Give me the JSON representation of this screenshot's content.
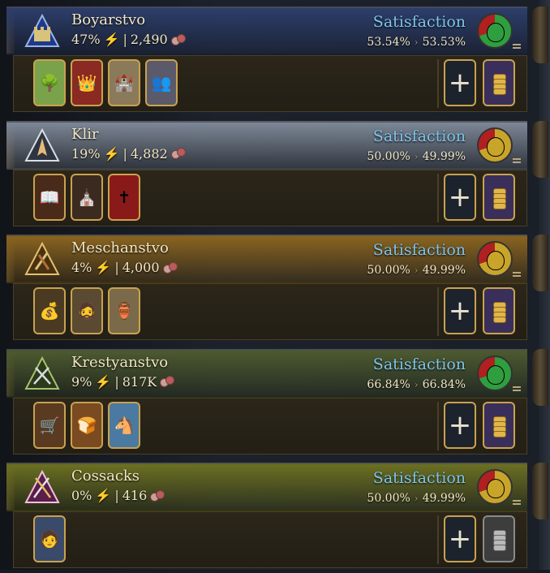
{
  "estates": [
    {
      "id": "boyarstvo",
      "name": "Boyarstvo",
      "influence": "47%",
      "population": "2,490",
      "satisfaction_label": "Satisfaction",
      "satisfaction_current": "53.54%",
      "satisfaction_next": "53.53%",
      "band_color": "#2d3e6b",
      "emblem_icon": "castle-icon",
      "gauge_color": "#2f9e3f",
      "cards": [
        "landscape-card-icon",
        "noble-lady-card-icon",
        "tower-card-icon",
        "noble-couple-card-icon"
      ],
      "grant_enabled": true
    },
    {
      "id": "klir",
      "name": "Klir",
      "influence": "19%",
      "population": "4,882",
      "satisfaction_label": "Satisfaction",
      "satisfaction_current": "50.00%",
      "satisfaction_next": "49.99%",
      "band_color": "#7d8796",
      "emblem_icon": "praying-hands-icon",
      "gauge_color": "#c8a52a",
      "cards": [
        "holy-book-card-icon",
        "monk-card-icon",
        "bishop-mitre-card-icon"
      ],
      "grant_enabled": true
    },
    {
      "id": "meschanstvo",
      "name": "Meschanstvo",
      "influence": "4%",
      "population": "4,000",
      "satisfaction_label": "Satisfaction",
      "satisfaction_current": "50.00%",
      "satisfaction_next": "49.99%",
      "band_color": "#8a6420",
      "emblem_icon": "tools-icon",
      "gauge_color": "#c8a52a",
      "cards": [
        "coin-purse-card-icon",
        "merchant-card-icon",
        "market-stall-card-icon"
      ],
      "grant_enabled": true
    },
    {
      "id": "krestyanstvo",
      "name": "Krestyanstvo",
      "influence": "9%",
      "population": "817K",
      "satisfaction_label": "Satisfaction",
      "satisfaction_current": "66.84%",
      "satisfaction_next": "66.84%",
      "band_color": "#4d5a30",
      "emblem_icon": "pitchfork-icon",
      "gauge_color": "#2f9e3f",
      "cards": [
        "hay-cart-card-icon",
        "bread-card-icon",
        "horse-card-icon"
      ],
      "grant_enabled": true
    },
    {
      "id": "cossacks",
      "name": "Cossacks",
      "influence": "0%",
      "population": "416",
      "satisfaction_label": "Satisfaction",
      "satisfaction_current": "50.00%",
      "satisfaction_next": "49.99%",
      "band_color": "#6b7022",
      "emblem_icon": "crossed-sabres-icon",
      "gauge_color": "#c8a52a",
      "cards": [
        "cossack-portrait-card-icon"
      ],
      "grant_enabled": false
    }
  ],
  "colors": {
    "satisfaction_text": "#7fc6ec",
    "card_border": "#c9a24e",
    "influence_icon": "#f2c12e"
  }
}
